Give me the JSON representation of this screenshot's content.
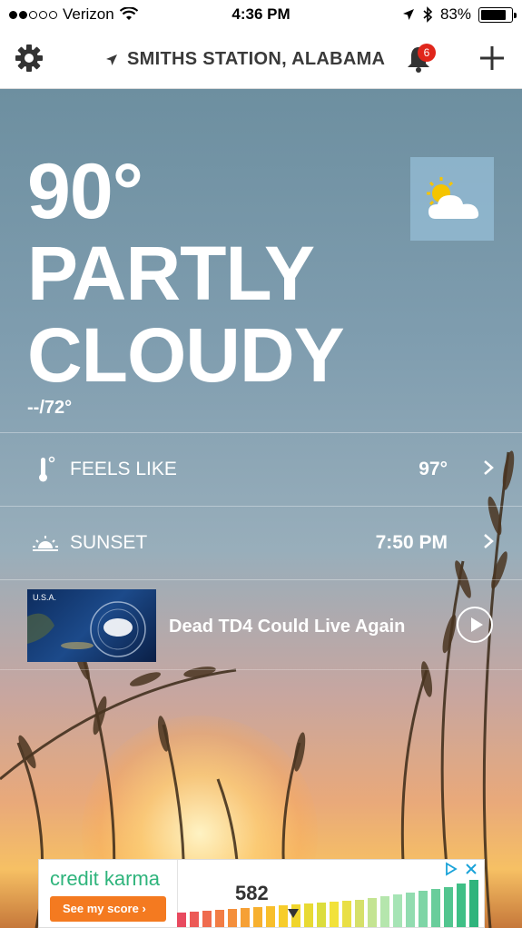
{
  "status_bar": {
    "carrier": "Verizon",
    "time": "4:36 PM",
    "battery": "83%",
    "signal_bars": 2,
    "battery_level": 0.83
  },
  "nav": {
    "location": "SMITHS STATION, ALABAMA",
    "notification_count": "6"
  },
  "current": {
    "temperature": "90°",
    "condition": "PARTLY CLOUDY",
    "hi_lo": "--/72°",
    "icon": "partly-cloudy-icon"
  },
  "details": [
    {
      "label": "FEELS LIKE",
      "value": "97°",
      "icon": "thermometer-icon"
    },
    {
      "label": "SUNSET",
      "value": "7:50 PM",
      "icon": "sunset-icon"
    }
  ],
  "video": {
    "title": "Dead TD4 Could Live Again",
    "thumb_label": "U.S.A."
  },
  "ad": {
    "brand": "credit karma",
    "cta": "See my score",
    "score": "582",
    "brand_color": "#2fb47c",
    "cta_color": "#f47a20"
  }
}
